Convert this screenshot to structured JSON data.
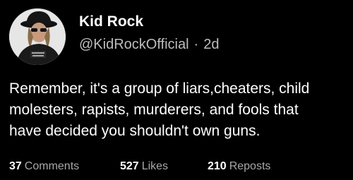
{
  "post": {
    "author": {
      "display_name": "Kid Rock",
      "handle": "@KidRockOfficial",
      "separator": "·",
      "time_ago": "2d",
      "avatar_icon": "profile-photo"
    },
    "text_lines": [
      "Remember, it's a group of liars,cheaters, child",
      "molesters, rapists, murderers, and fools that",
      "have decided you shouldn't own guns."
    ],
    "stats": {
      "comments": {
        "count": "37",
        "label": "Comments"
      },
      "likes": {
        "count": "527",
        "label": "Likes"
      },
      "reposts": {
        "count": "210",
        "label": "Reposts"
      }
    }
  },
  "colors": {
    "background": "#000000",
    "primary_text": "#ffffff",
    "secondary_text": "#bdbdbd",
    "stat_label": "#a8a8a8"
  }
}
